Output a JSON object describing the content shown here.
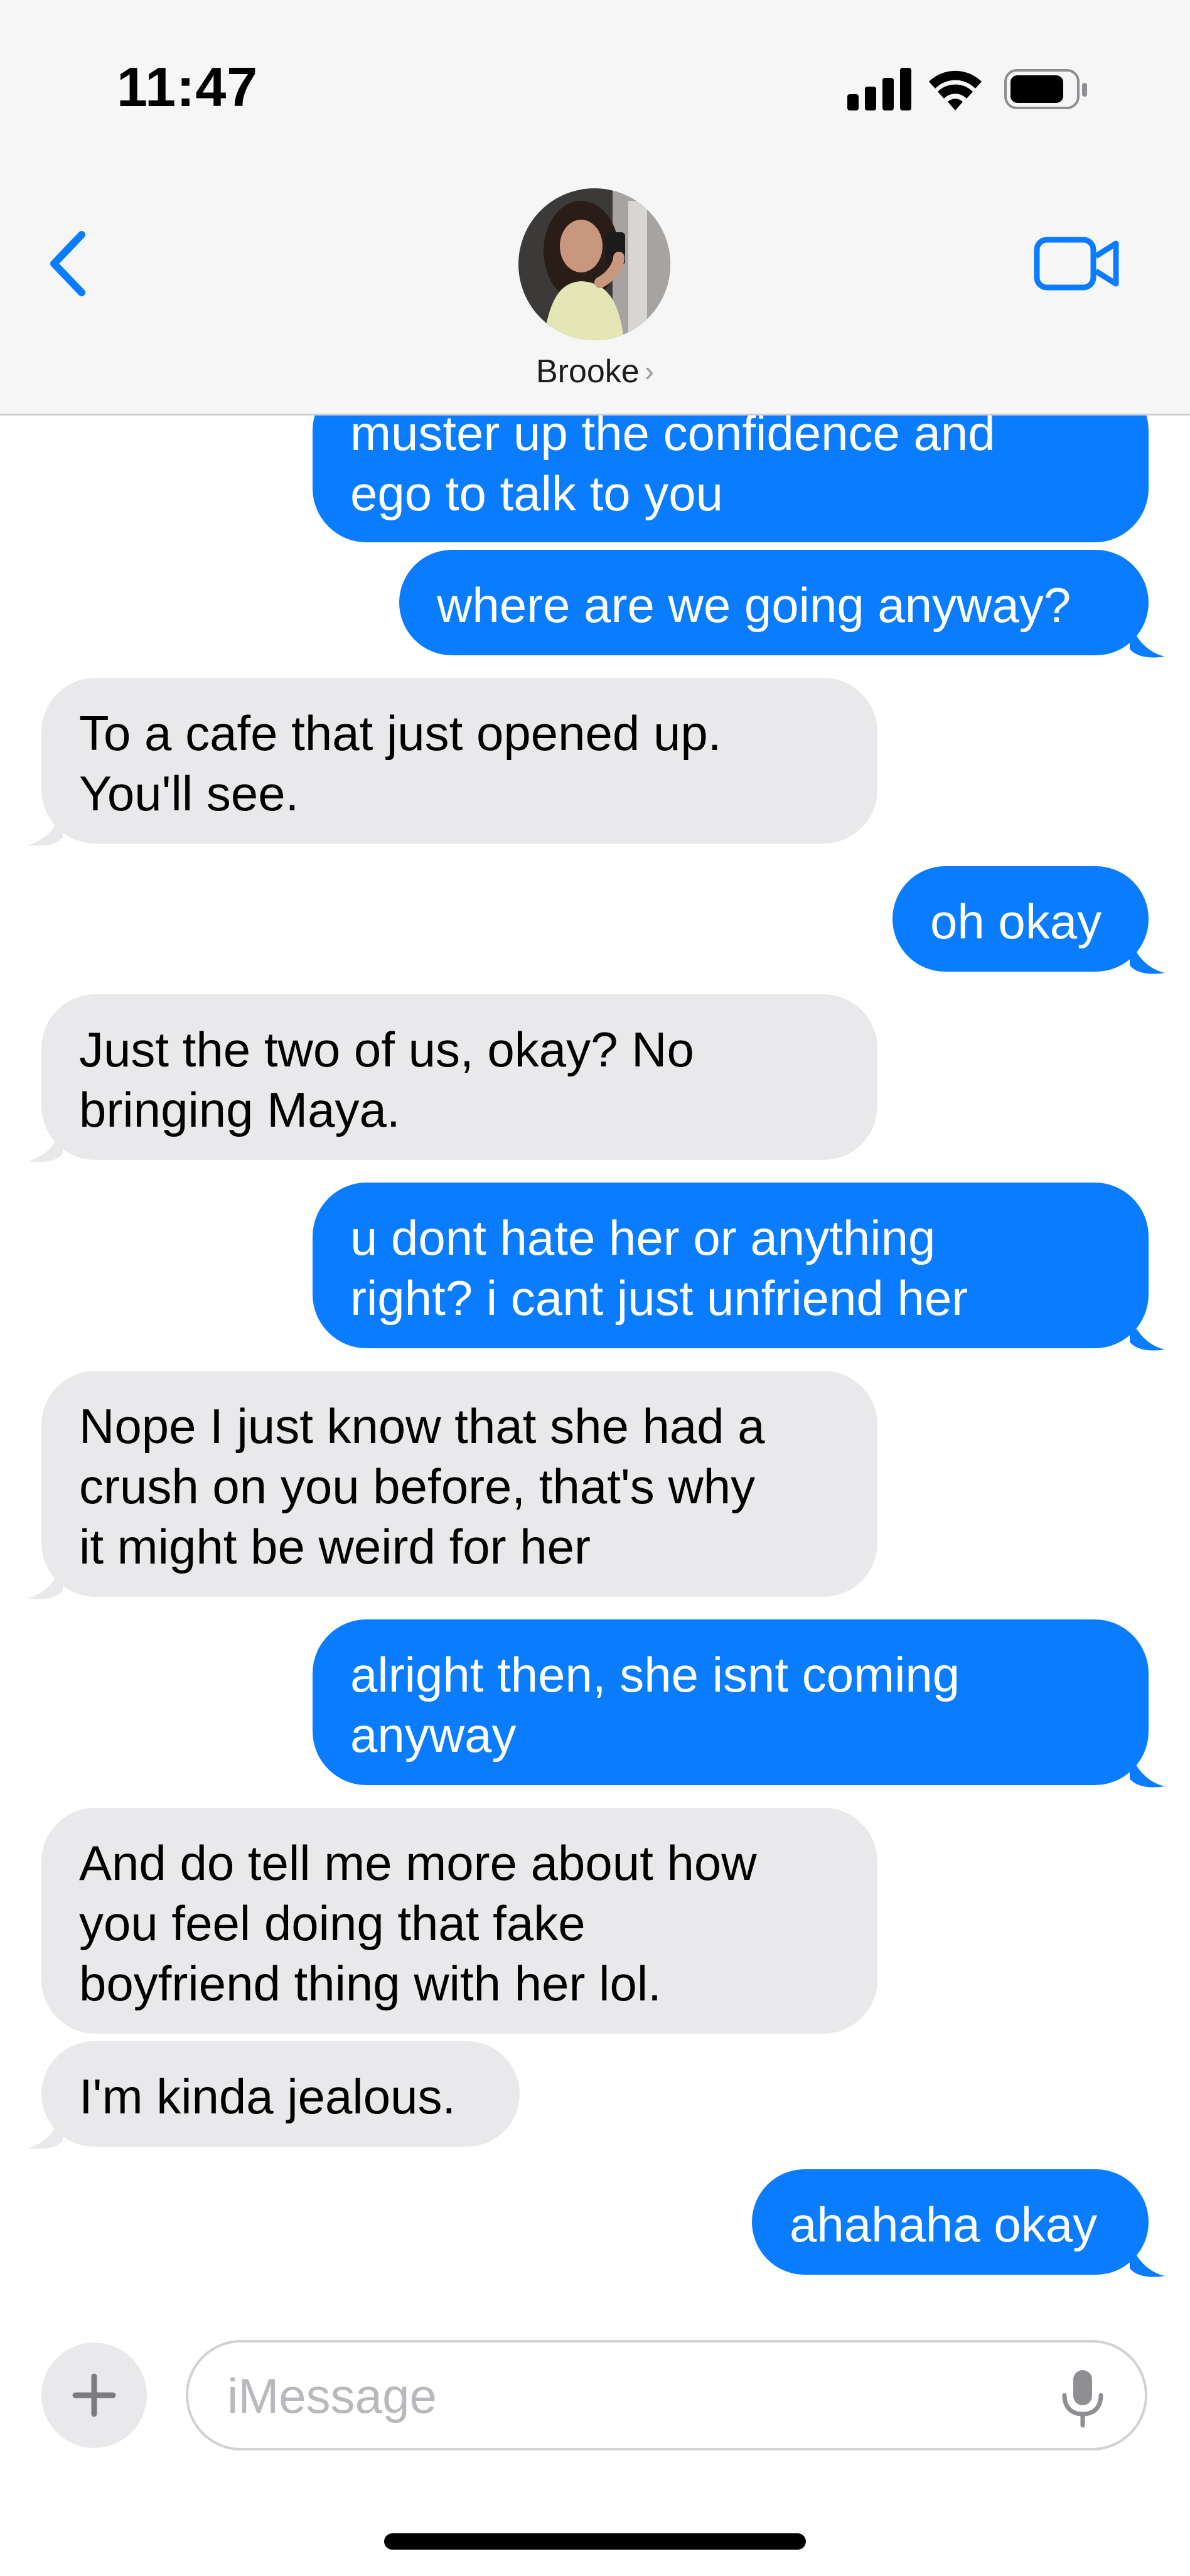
{
  "status_bar": {
    "time": "11:47"
  },
  "header": {
    "contact_name": "Brooke",
    "chevron": "›",
    "back_icon": "chevron-left-icon",
    "video_icon": "video-camera-icon"
  },
  "colors": {
    "sent_bubble": "#0a7cff",
    "received_bubble": "#e9e9eb",
    "accent": "#0a7cff"
  },
  "messages": [
    {
      "from": "me",
      "text": "muster up the confidence and\nego to talk to you"
    },
    {
      "from": "me",
      "text": "where are we going anyway?"
    },
    {
      "from": "them",
      "text": "To a cafe that just opened up.\nYou'll see."
    },
    {
      "from": "me",
      "text": "oh okay"
    },
    {
      "from": "them",
      "text": "Just the two of us, okay? No\nbringing Maya."
    },
    {
      "from": "me",
      "text": "u dont hate her or anything\nright? i cant just unfriend her"
    },
    {
      "from": "them",
      "text": "Nope I just know that she had a\ncrush on you before, that's why\nit might be weird for her"
    },
    {
      "from": "me",
      "text": "alright then, she isnt coming\nanyway"
    },
    {
      "from": "them",
      "text": "And do tell me more about how\nyou feel doing that fake\nboyfriend thing with her lol."
    },
    {
      "from": "them",
      "text": "I'm kinda jealous."
    },
    {
      "from": "me",
      "text": "ahahaha okay"
    }
  ],
  "composer": {
    "placeholder": "iMessage",
    "value": "",
    "plus_label": "+",
    "mic_icon": "microphone-icon"
  }
}
